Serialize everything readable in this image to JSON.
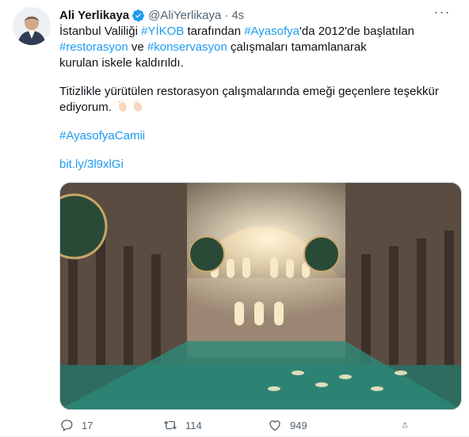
{
  "tweet": {
    "author_name": "Ali Yerlikaya",
    "handle": "@AliYerlikaya",
    "separator": "·",
    "time": "4s",
    "more": "···",
    "lines": {
      "l1_a": "İstanbul Valiliği ",
      "l1_tag1": "#YİKOB",
      "l1_b": " tarafından ",
      "l1_tag2": "#Ayasofya",
      "l1_c": "'da 2012'de başlatılan",
      "l2_tag": "#restorasyon",
      "l2_b": " ve ",
      "l2_tag2": "#konservasyon",
      "l2_c": " çalışmaları tamamlanarak",
      "l3": "kurulan iskele kaldırıldı.",
      "l4": "Titizlikle yürütülen restorasyon çalışmalarında emeği geçenlere teşekkür",
      "l5": "ediyorum.",
      "hashtag": "#AyasofyaCamii",
      "link": "bit.ly/3l9xlGi"
    },
    "icons": [
      "avatar",
      "verified-badge-icon",
      "clapping-hands-icon",
      "reply-icon",
      "retweet-icon",
      "like-icon",
      "share-icon"
    ],
    "colors": {
      "accent": "#1d9bf0",
      "text": "#0f1419",
      "muted": "#536471"
    }
  },
  "stats": {
    "replies": "17",
    "retweets": "114",
    "likes": "949"
  }
}
